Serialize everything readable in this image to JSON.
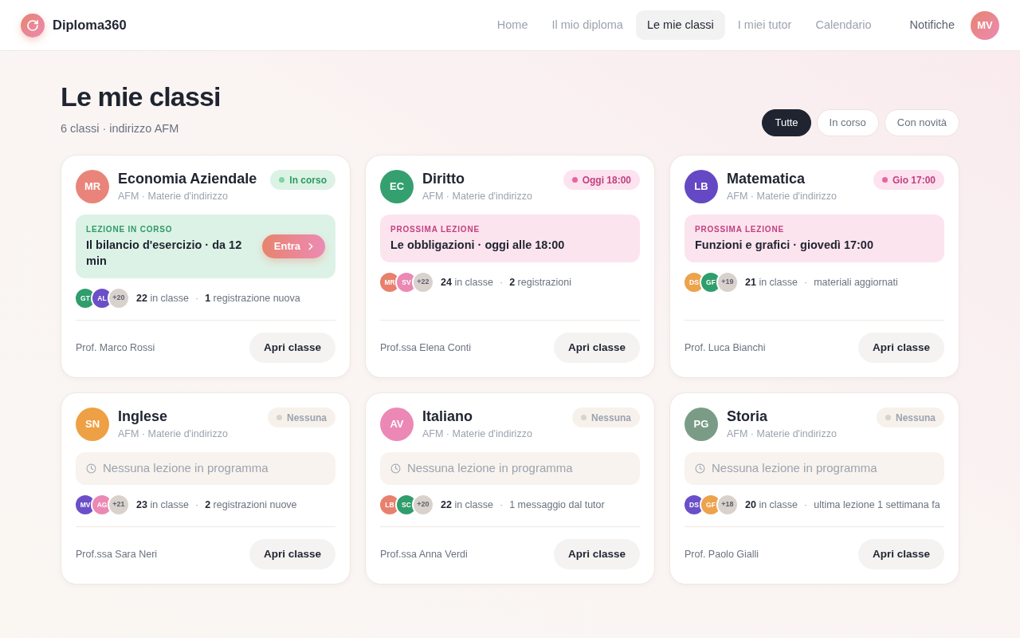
{
  "header": {
    "brand": "Diploma360",
    "nav": [
      {
        "label": "Home",
        "selected": false
      },
      {
        "label": "Il mio diploma",
        "selected": false
      },
      {
        "label": "Le mie classi",
        "selected": true
      },
      {
        "label": "I miei tutor",
        "selected": false
      },
      {
        "label": "Calendario",
        "selected": false
      }
    ],
    "notifications": "Notifiche",
    "user_initials": "MV"
  },
  "page": {
    "title": "Le mie classi",
    "subtitle": "6 classi · indirizzo AFM"
  },
  "filters": [
    {
      "label": "Tutte",
      "selected": true
    },
    {
      "label": "In corso",
      "selected": false
    },
    {
      "label": "Con novità",
      "selected": false
    }
  ],
  "classes": [
    {
      "initials": "MR",
      "color": "#e9847a",
      "subject": "Economia Aziendale",
      "meta": "AFM · Materie d'indirizzo",
      "status": {
        "kind": "live",
        "label": "In corso"
      },
      "lesson": {
        "kind": "live",
        "label": "LEZIONE IN CORSO",
        "title": "Il bilancio d'esercizio · da 12 min",
        "action": "Entra"
      },
      "members": [
        {
          "initials": "GT",
          "color": "#2f9e6c"
        },
        {
          "initials": "AL",
          "color": "#6a4fc8"
        }
      ],
      "more": "+20",
      "enrolled": "**22** in classe",
      "separator": "·",
      "note": "**1** registrazione nuova",
      "teacher": "Prof. Marco Rossi",
      "button": "Apri classe"
    },
    {
      "initials": "EC",
      "color": "#34a06f",
      "subject": "Diritto",
      "meta": "AFM · Materie d'indirizzo",
      "status": {
        "kind": "scheduled",
        "label": "Oggi 18:00"
      },
      "lesson": {
        "kind": "next",
        "label": "PROSSIMA LEZIONE",
        "title": "Le obbligazioni · oggi alle 18:00"
      },
      "members": [
        {
          "initials": "MR",
          "color": "#e8806e"
        },
        {
          "initials": "SV",
          "color": "#eb88b4"
        }
      ],
      "more": "+22",
      "enrolled": "**24** in classe",
      "separator": "·",
      "note": "**2** registrazioni",
      "teacher": "Prof.ssa Elena Conti",
      "button": "Apri classe"
    },
    {
      "initials": "LB",
      "color": "#6448c4",
      "subject": "Matematica",
      "meta": "AFM · Materie d'indirizzo",
      "status": {
        "kind": "scheduled",
        "label": "Gio 17:00"
      },
      "lesson": {
        "kind": "next",
        "label": "PROSSIMA LEZIONE",
        "title": "Funzioni e grafici · giovedì 17:00"
      },
      "members": [
        {
          "initials": "DS",
          "color": "#eda24c"
        },
        {
          "initials": "GF",
          "color": "#2f9e6c"
        }
      ],
      "more": "+19",
      "enrolled": "**21** in classe",
      "separator": "·",
      "note": "materiali aggiornati",
      "teacher": "Prof. Luca Bianchi",
      "button": "Apri classe"
    },
    {
      "initials": "SN",
      "color": "#eea045",
      "subject": "Inglese",
      "meta": "AFM · Materie d'indirizzo",
      "status": {
        "kind": "none",
        "label": "Nessuna"
      },
      "lesson": {
        "kind": "none",
        "title": "Nessuna lezione in programma"
      },
      "members": [
        {
          "initials": "MV",
          "color": "#6a4fc8"
        },
        {
          "initials": "AG",
          "color": "#eb88b4"
        }
      ],
      "more": "+21",
      "enrolled": "**23** in classe",
      "separator": "·",
      "note": "**2** registrazioni nuove",
      "teacher": "Prof.ssa Sara Neri",
      "button": "Apri classe"
    },
    {
      "initials": "AV",
      "color": "#ec88b6",
      "subject": "Italiano",
      "meta": "AFM · Materie d'indirizzo",
      "status": {
        "kind": "none",
        "label": "Nessuna"
      },
      "lesson": {
        "kind": "none",
        "title": "Nessuna lezione in programma"
      },
      "members": [
        {
          "initials": "LB",
          "color": "#e8806e"
        },
        {
          "initials": "SC",
          "color": "#2f9e6c"
        }
      ],
      "more": "+20",
      "enrolled": "**22** in classe",
      "separator": "·",
      "note": "1 messaggio dal tutor",
      "teacher": "Prof.ssa Anna Verdi",
      "button": "Apri classe"
    },
    {
      "initials": "PG",
      "color": "#7a9c86",
      "subject": "Storia",
      "meta": "AFM · Materie d'indirizzo",
      "status": {
        "kind": "none",
        "label": "Nessuna"
      },
      "lesson": {
        "kind": "none",
        "title": "Nessuna lezione in programma"
      },
      "members": [
        {
          "initials": "DS",
          "color": "#6a4fc8"
        },
        {
          "initials": "GF",
          "color": "#eda24c"
        }
      ],
      "more": "+18",
      "enrolled": "**20** in classe",
      "separator": "·",
      "note": "ultima lezione 1 settimana fa",
      "teacher": "Prof. Paolo Gialli",
      "button": "Apri classe"
    }
  ]
}
